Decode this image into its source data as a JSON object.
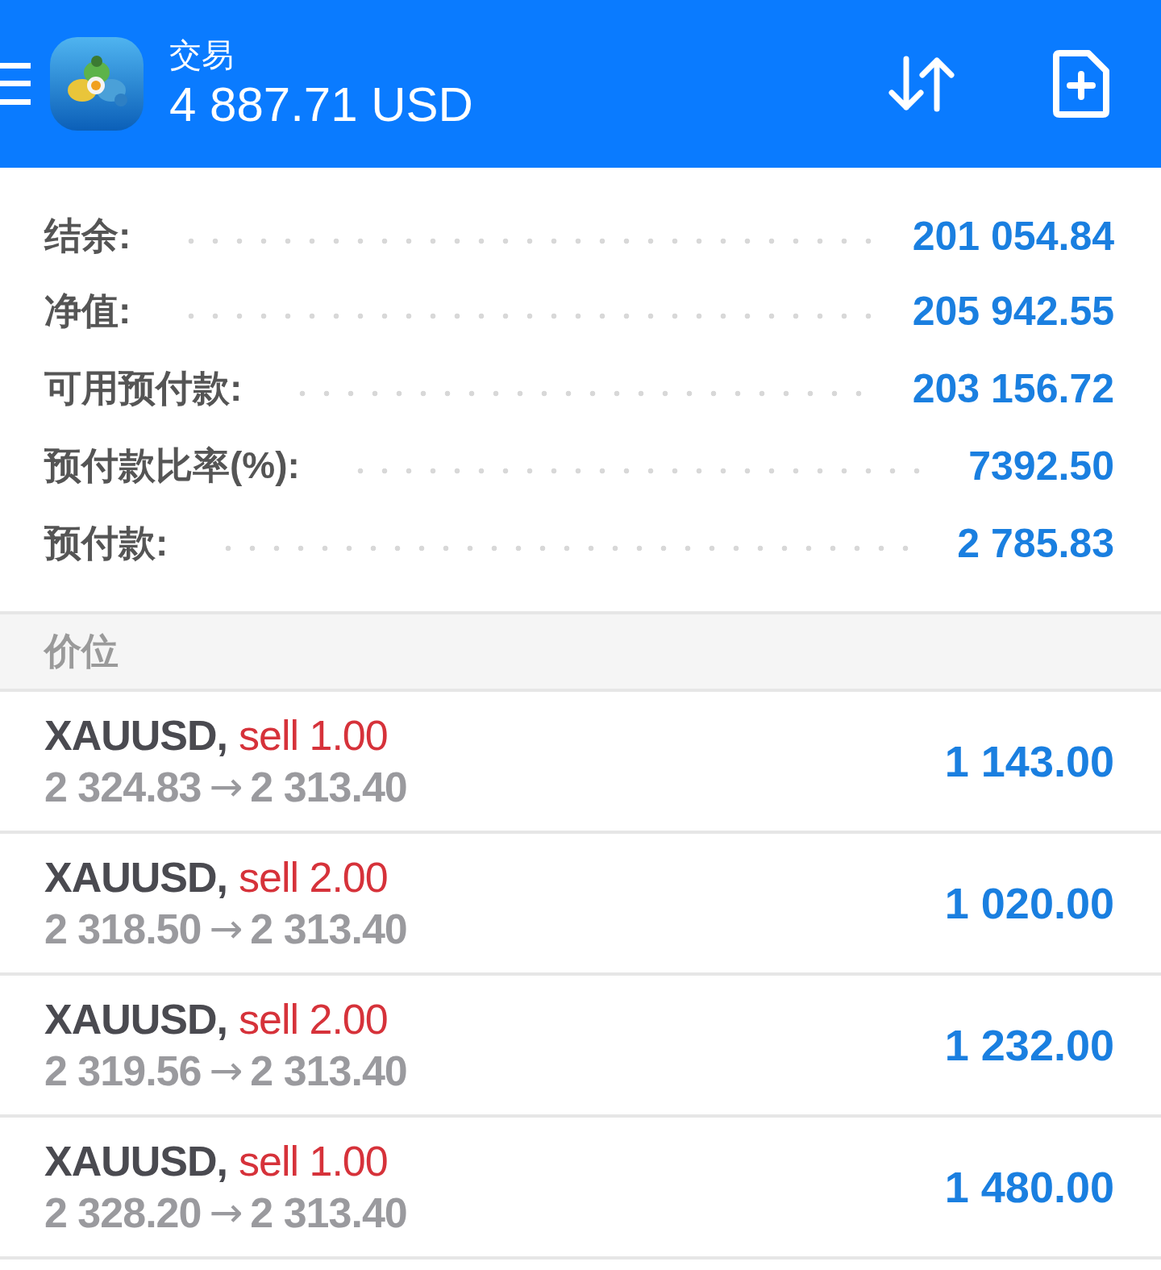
{
  "header": {
    "title": "交易",
    "balance": "4 887.71 USD"
  },
  "summary": [
    {
      "label": "结余:",
      "value": "201 054.84"
    },
    {
      "label": "净值:",
      "value": "205 942.55"
    },
    {
      "label": "可用预付款:",
      "value": "203 156.72"
    },
    {
      "label": "预付款比率(%):",
      "value": "7392.50"
    },
    {
      "label": "预付款:",
      "value": "2 785.83"
    }
  ],
  "section": {
    "title": "价位"
  },
  "positions": [
    {
      "symbol": "XAUUSD,",
      "side": "sell 1.00",
      "open": "2 324.83",
      "arrow": "→",
      "current": "2 313.40",
      "profit": "1 143.00"
    },
    {
      "symbol": "XAUUSD,",
      "side": "sell 2.00",
      "open": "2 318.50",
      "arrow": "→",
      "current": "2 313.40",
      "profit": "1 020.00"
    },
    {
      "symbol": "XAUUSD,",
      "side": "sell 2.00",
      "open": "2 319.56",
      "arrow": "→",
      "current": "2 313.40",
      "profit": "1 232.00"
    },
    {
      "symbol": "XAUUSD,",
      "side": "sell 1.00",
      "open": "2 328.20",
      "arrow": "→",
      "current": "2 313.40",
      "profit": "1 480.00"
    }
  ]
}
